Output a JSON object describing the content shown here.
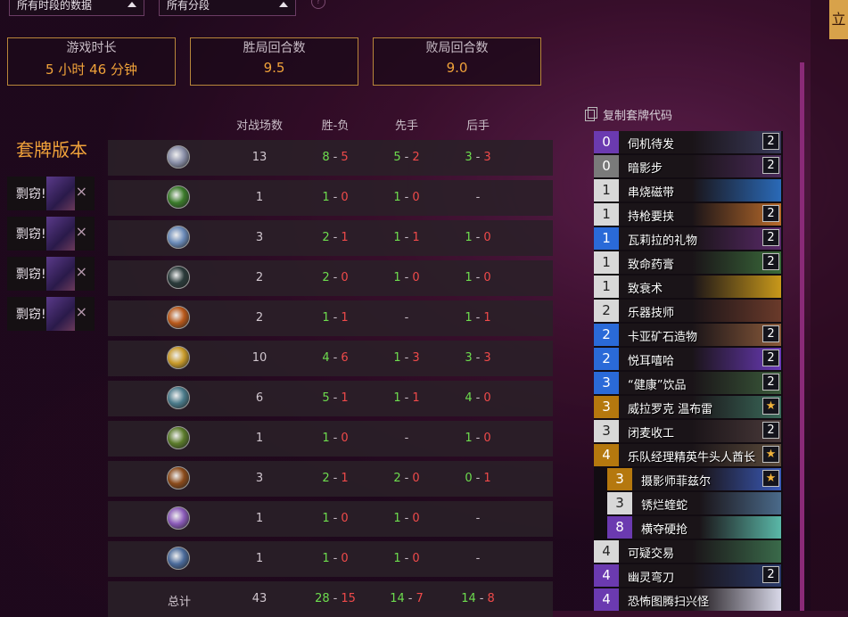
{
  "filters": {
    "time_range": "所有时段的数据",
    "rank_range": "所有分段"
  },
  "help_icon": "?",
  "stats": [
    {
      "label": "游戏时长",
      "value": "5 小时 46 分钟"
    },
    {
      "label": "胜局回合数",
      "value": "9.5"
    },
    {
      "label": "败局回合数",
      "value": "9.0"
    }
  ],
  "side": {
    "title": "套牌版本",
    "versions": [
      "剽窃!",
      "剽窃!",
      "剽窃!",
      "剽窃!"
    ],
    "remove_icon": "×"
  },
  "table": {
    "headers": [
      "对战场数",
      "胜-负",
      "先手",
      "后手"
    ],
    "rows": [
      {
        "icon": "overall-icon",
        "color": "#8a8fa8",
        "games": "13",
        "w": "8",
        "l": "5",
        "fw": "5",
        "fl": "2",
        "sw": "3",
        "sl": "3"
      },
      {
        "icon": "druid-icon",
        "color": "#3a7a2a",
        "games": "1",
        "w": "1",
        "l": "0",
        "fw": "1",
        "fl": "0",
        "sw": "",
        "sl": ""
      },
      {
        "icon": "mage-icon",
        "color": "#6a8ab8",
        "games": "3",
        "w": "2",
        "l": "1",
        "fw": "1",
        "fl": "1",
        "sw": "1",
        "sl": "0"
      },
      {
        "icon": "rogue-icon",
        "color": "#2a3a3a",
        "games": "2",
        "w": "2",
        "l": "0",
        "fw": "1",
        "fl": "0",
        "sw": "1",
        "sl": "0"
      },
      {
        "icon": "warrior-icon",
        "color": "#b8581a",
        "games": "2",
        "w": "1",
        "l": "1",
        "fw": "",
        "fl": "",
        "sw": "1",
        "sl": "1"
      },
      {
        "icon": "paladin-icon",
        "color": "#c89a2a",
        "games": "10",
        "w": "4",
        "l": "6",
        "fw": "1",
        "fl": "3",
        "sw": "3",
        "sl": "3"
      },
      {
        "icon": "shaman-icon",
        "color": "#4a7a8a",
        "games": "6",
        "w": "5",
        "l": "1",
        "fw": "1",
        "fl": "1",
        "sw": "4",
        "sl": "0"
      },
      {
        "icon": "hunter-icon",
        "color": "#5a7a2a",
        "games": "1",
        "w": "1",
        "l": "0",
        "fw": "",
        "fl": "",
        "sw": "1",
        "sl": "0"
      },
      {
        "icon": "warlock-icon",
        "color": "#8a4a1a",
        "games": "3",
        "w": "2",
        "l": "1",
        "fw": "2",
        "fl": "0",
        "sw": "0",
        "sl": "1"
      },
      {
        "icon": "priest-icon",
        "color": "#8a5ab8",
        "games": "1",
        "w": "1",
        "l": "0",
        "fw": "1",
        "fl": "0",
        "sw": "",
        "sl": ""
      },
      {
        "icon": "demonhunter-icon",
        "color": "#4a6a9a",
        "games": "1",
        "w": "1",
        "l": "0",
        "fw": "1",
        "fl": "0",
        "sw": "",
        "sl": ""
      }
    ],
    "total": {
      "label": "总计",
      "games": "43",
      "w": "28",
      "l": "15",
      "fw": "14",
      "fl": "7",
      "sw": "14",
      "sl": "8"
    },
    "dash": "-"
  },
  "deck": {
    "copy_label": "复制套牌代码",
    "cards": [
      {
        "cost": "0",
        "name": "伺机待发",
        "count": "2",
        "rarity": "epic",
        "art": "#3a3a5a"
      },
      {
        "cost": "0",
        "name": "暗影步",
        "count": "2",
        "rarity": "common",
        "art": "#4a2a5a"
      },
      {
        "cost": "1",
        "name": "串烧磁带",
        "count": "",
        "rarity": "free",
        "art": "#2a6ab8"
      },
      {
        "cost": "1",
        "name": "持枪要挟",
        "count": "2",
        "rarity": "free",
        "art": "#b86a2a"
      },
      {
        "cost": "1",
        "name": "瓦莉拉的礼物",
        "count": "2",
        "rarity": "rare",
        "art": "#5a2a6a"
      },
      {
        "cost": "1",
        "name": "致命药膏",
        "count": "2",
        "rarity": "free",
        "art": "#3a6a3a"
      },
      {
        "cost": "1",
        "name": "致衰术",
        "count": "",
        "rarity": "free",
        "art": "#c8981a"
      },
      {
        "cost": "2",
        "name": "乐器技师",
        "count": "",
        "rarity": "free",
        "art": "#6a3a2a"
      },
      {
        "cost": "2",
        "name": "卡亚矿石造物",
        "count": "2",
        "rarity": "rare",
        "art": "#8a5a3a"
      },
      {
        "cost": "2",
        "name": "悦耳嘻哈",
        "count": "2",
        "rarity": "rare",
        "art": "#6a3ab8"
      },
      {
        "cost": "3",
        "name": "“健康”饮品",
        "count": "2",
        "rarity": "rare",
        "art": "#3a5a3a"
      },
      {
        "cost": "3",
        "name": "威拉罗克 温布雷",
        "count": "★",
        "rarity": "leg",
        "art": "#3a6a5a"
      },
      {
        "cost": "3",
        "name": "闭麦收工",
        "count": "2",
        "rarity": "free",
        "art": "#4a3a3a"
      },
      {
        "cost": "4",
        "name": "乐队经理精英牛头人酋长",
        "count": "★",
        "rarity": "leg",
        "art": "#5a4a3a"
      },
      {
        "cost": "3",
        "name": "摄影师菲兹尔",
        "count": "★",
        "rarity": "leg",
        "art": "#3a5ab8",
        "sub": true
      },
      {
        "cost": "3",
        "name": "锈烂蝰蛇",
        "count": "",
        "rarity": "free",
        "art": "#4a6a8a",
        "sub": true
      },
      {
        "cost": "8",
        "name": "横夺硬抢",
        "count": "",
        "rarity": "epic",
        "art": "#5ab8a8",
        "sub": true
      },
      {
        "cost": "4",
        "name": "可疑交易",
        "count": "",
        "rarity": "free",
        "art": "#3a6a4a"
      },
      {
        "cost": "4",
        "name": "幽灵弯刀",
        "count": "2",
        "rarity": "epic",
        "art": "#2a3a6a"
      },
      {
        "cost": "4",
        "name": "恐怖图腾扫兴怪",
        "count": "",
        "rarity": "epic",
        "art": "#d8d8e8"
      }
    ]
  },
  "corner_button": "立"
}
